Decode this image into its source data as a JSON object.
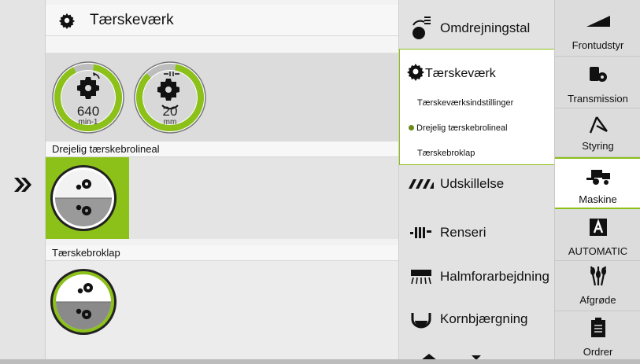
{
  "header": {
    "title": "Tærskeværk",
    "icon": "gear-icon"
  },
  "left": {
    "collapse_icon": "double-chevron-right-icon"
  },
  "gauges": [
    {
      "name": "drum-speed",
      "value": "640",
      "unit": "min-1",
      "icon": "gear-rotate-icon",
      "fill": 0.9,
      "color": "#8cc11a"
    },
    {
      "name": "concave-gap",
      "value": "20",
      "unit": "mm",
      "icon": "gear-gap-icon",
      "fill": 0.85,
      "color": "#8cc11a"
    }
  ],
  "sections": [
    {
      "label": "Drejelig tærskebrolineal",
      "active": true
    },
    {
      "label": "Tærskebroklap",
      "active": false
    }
  ],
  "menu": {
    "top_item": {
      "label": "Omdrejningstal",
      "icon": "rpm-list-icon"
    },
    "expanded": {
      "label": "Tærskeværk",
      "icon": "gear-icon",
      "submenu": [
        {
          "label": "Tærskeværksindstillinger",
          "selected": false
        },
        {
          "label": "Drejelig tærskebrolineal",
          "selected": true
        },
        {
          "label": "Tærskebroklap",
          "selected": false
        }
      ]
    },
    "items": [
      {
        "label": "Udskillelse",
        "icon": "separation-icon"
      },
      {
        "label": "Renseri",
        "icon": "cleaning-icon"
      },
      {
        "label": "Halmforarbejdning",
        "icon": "straw-chopper-icon"
      },
      {
        "label": "Kornbjærgning",
        "icon": "grain-tank-icon"
      }
    ]
  },
  "nav": [
    {
      "label": "Frontudstyr",
      "icon": "header-wedge-icon",
      "active": false
    },
    {
      "label": "Transmission",
      "icon": "transmission-icon",
      "active": false
    },
    {
      "label": "Styring",
      "icon": "steering-icon",
      "active": false
    },
    {
      "label": "Maskine",
      "icon": "combine-icon",
      "active": true
    },
    {
      "label": "AUTOMATIC",
      "icon": "automatic-a-icon",
      "active": false
    },
    {
      "label": "Afgrøde",
      "icon": "crop-icon",
      "active": false
    },
    {
      "label": "Ordrer",
      "icon": "clipboard-icon",
      "active": false
    }
  ],
  "colors": {
    "accent": "#8cc11a",
    "dark": "#111111",
    "panel": "#e4e4e4"
  }
}
